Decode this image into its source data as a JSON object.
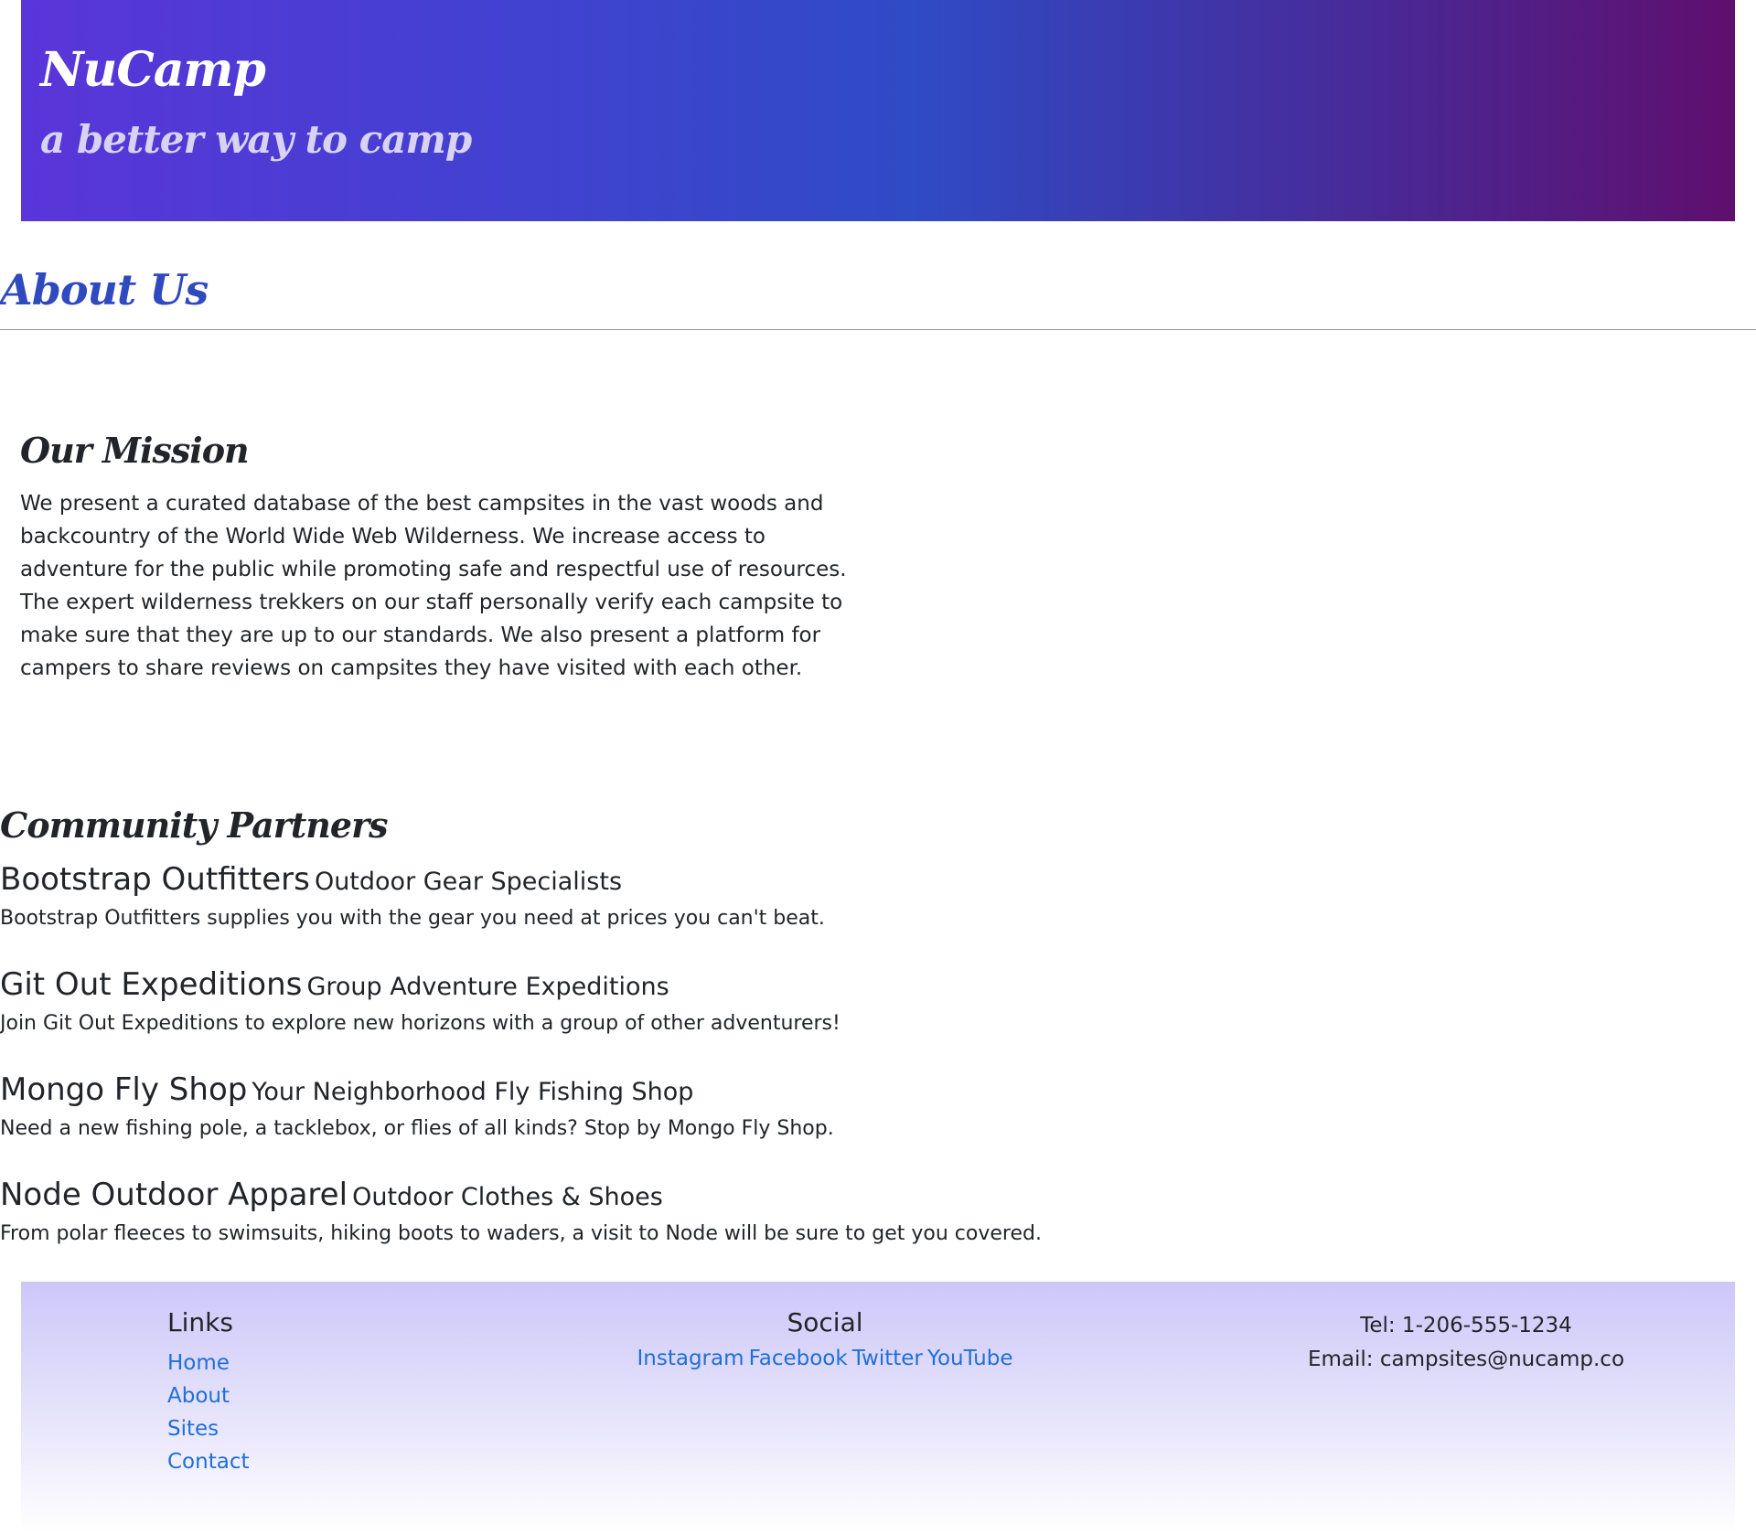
{
  "header": {
    "brand": "NuCamp",
    "tagline": "a better way to camp"
  },
  "page": {
    "title": "About Us"
  },
  "mission": {
    "title": "Our Mission",
    "text": "We present a curated database of the best campsites in the vast woods and backcountry of the World Wide Web Wilderness. We increase access to adventure for the public while promoting safe and respectful use of resources. The expert wilderness trekkers on our staff personally verify each campsite to make sure that they are up to our standards. We also present a platform for campers to share reviews on campsites they have visited with each other."
  },
  "partners": {
    "title": "Community Partners",
    "items": [
      {
        "name": "Bootstrap Outfitters",
        "subtitle": "Outdoor Gear Specialists",
        "description": "Bootstrap Outfitters supplies you with the gear you need at prices you can't beat."
      },
      {
        "name": "Git Out Expeditions",
        "subtitle": "Group Adventure Expeditions",
        "description": "Join Git Out Expeditions to explore new horizons with a group of other adventurers!"
      },
      {
        "name": "Mongo Fly Shop",
        "subtitle": "Your Neighborhood Fly Fishing Shop",
        "description": "Need a new fishing pole, a tacklebox, or flies of all kinds? Stop by Mongo Fly Shop."
      },
      {
        "name": "Node Outdoor Apparel",
        "subtitle": "Outdoor Clothes & Shoes",
        "description": "From polar fleeces to swimsuits, hiking boots to waders, a visit to Node will be sure to get you covered."
      }
    ]
  },
  "footer": {
    "links_title": "Links",
    "links": [
      "Home",
      "About",
      "Sites",
      "Contact"
    ],
    "social_title": "Social",
    "social": [
      "Instagram",
      "Facebook",
      "Twitter",
      "YouTube"
    ],
    "tel": "Tel: 1-206-555-1234",
    "email": "Email: campsites@nucamp.co"
  },
  "colors": {
    "header_gradient_start": "#5a35d9",
    "header_gradient_mid": "#2f4bc6",
    "header_gradient_end": "#5f0f6e",
    "title_blue": "#2f49bf",
    "link_blue": "#1f6fd8",
    "footer_lavender": "#cdc7f9"
  }
}
